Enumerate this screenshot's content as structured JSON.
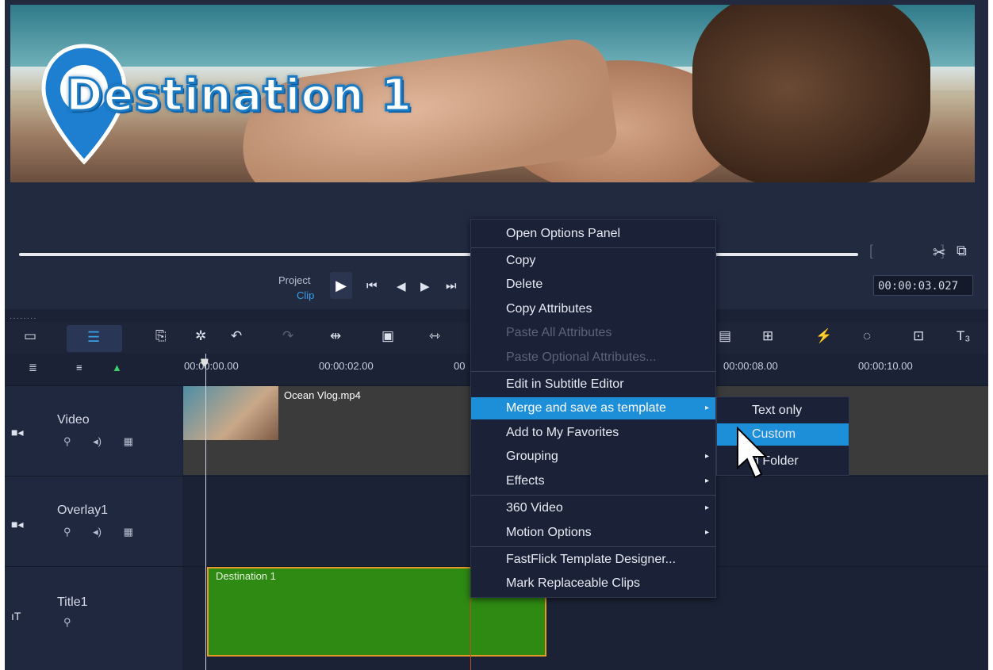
{
  "preview": {
    "overlay_title": "Destination 1",
    "mode_project": "Project",
    "mode_clip": "Clip",
    "timecode": "00:00:03.027"
  },
  "timeline": {
    "ruler_ticks": [
      "00:00:00.00",
      "00:00:02.00",
      "00",
      "00:00:08.00",
      "00:00:10.00"
    ],
    "tracks": [
      {
        "name": "Video",
        "icon": "video-track-icon"
      },
      {
        "name": "Overlay1",
        "icon": "overlay-track-icon"
      },
      {
        "name": "Title1",
        "icon": "title-track-icon"
      }
    ],
    "video_clip_label": "Ocean Vlog.mp4",
    "title_clip_label": "Destination 1"
  },
  "context_menu": {
    "items": [
      {
        "label": "Open Options Panel",
        "disabled": false
      },
      {
        "label": "Copy",
        "disabled": false
      },
      {
        "label": "Delete",
        "disabled": false
      },
      {
        "label": "Copy Attributes",
        "disabled": false
      },
      {
        "label": "Paste All Attributes",
        "disabled": true
      },
      {
        "label": "Paste Optional Attributes...",
        "disabled": true
      },
      {
        "label": "Edit in Subtitle Editor",
        "disabled": false
      },
      {
        "label": "Merge and save as template",
        "disabled": false,
        "active": true,
        "submenu": true
      },
      {
        "label": "Add to My Favorites",
        "disabled": false
      },
      {
        "label": "Grouping",
        "disabled": false,
        "submenu": true
      },
      {
        "label": "Effects",
        "disabled": false,
        "submenu": true
      },
      {
        "label": "360 Video",
        "disabled": false,
        "submenu": true
      },
      {
        "label": "Motion Options",
        "disabled": false,
        "submenu": true
      },
      {
        "label": "FastFlick Template Designer...",
        "disabled": false
      },
      {
        "label": "Mark Replaceable Clips",
        "disabled": false
      }
    ]
  },
  "submenu": {
    "items": [
      {
        "label": "Text only"
      },
      {
        "label": "Custom",
        "active": true
      },
      {
        "label": "d Folder"
      }
    ]
  },
  "colors": {
    "accent": "#1d8ed8",
    "title_clip": "#2e8a12",
    "title_clip_border": "#e39a26",
    "background": "#1b2235"
  }
}
